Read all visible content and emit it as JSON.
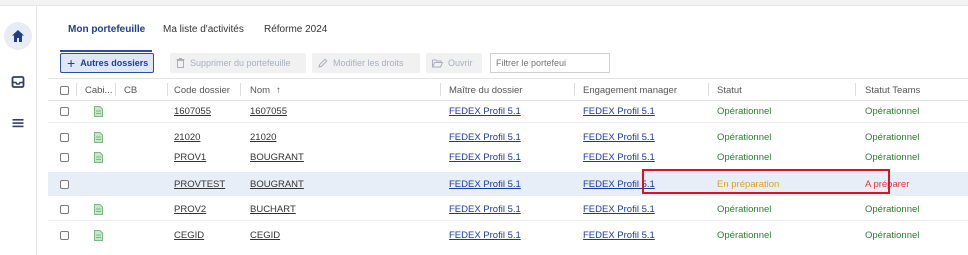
{
  "tabs": [
    {
      "label": "Mon portefeuille",
      "active": true
    },
    {
      "label": "Ma liste d'activités",
      "active": false
    },
    {
      "label": "Réforme 2024",
      "active": false
    }
  ],
  "toolbar": {
    "other_folders": "Autres dossiers",
    "delete_portfolio": "Supprimer du portefeuille",
    "modify_rights": "Modifier les droits",
    "open": "Ouvrir",
    "filter_placeholder": "Filtrer le portefeui"
  },
  "columns": [
    "Cabi...",
    "CB",
    "Code dossier",
    "Nom",
    "Maître du dossier",
    "Engagement manager",
    "Statut",
    "Statut Teams"
  ],
  "sort_indicator": "↑",
  "rows": [
    {
      "icon": true,
      "code": "1607055",
      "nom": "1607055",
      "maitre": "FEDEX Profil 5.1",
      "engagement": "FEDEX Profil 5.1",
      "statut": "Opérationnel",
      "statut_teams": "Opérationnel"
    },
    {
      "icon": true,
      "code": "21020",
      "nom": "21020",
      "maitre": "FEDEX Profil 5.1",
      "engagement": "FEDEX Profil 5.1",
      "statut": "Opérationnel",
      "statut_teams": "Opérationnel"
    },
    {
      "icon": true,
      "code": "PROV1",
      "nom": "BOUGRANT",
      "maitre": "FEDEX Profil 5.1",
      "engagement": "FEDEX Profil 5.1",
      "statut": "Opérationnel",
      "statut_teams": "Opérationnel"
    },
    {
      "icon": false,
      "code": "PROVTEST",
      "nom": "BOUGRANT",
      "maitre": "FEDEX Profil 5.1",
      "engagement": "FEDEX Profil 5.1",
      "statut": "En préparation",
      "statut_teams": "A préparer"
    },
    {
      "icon": true,
      "code": "PROV2",
      "nom": "BUCHART",
      "maitre": "FEDEX Profil 5.1",
      "engagement": "FEDEX Profil 5.1",
      "statut": "Opérationnel",
      "statut_teams": "Opérationnel"
    },
    {
      "icon": true,
      "code": "CEGID",
      "nom": "CEGID",
      "maitre": "FEDEX Profil 5.1",
      "engagement": "FEDEX Profil 5.1",
      "statut": "Opérationnel",
      "statut_teams": "Opérationnel"
    }
  ],
  "colors": {
    "accent": "#2b4fa0",
    "ok": "#2e7d32",
    "warning": "#e0a020",
    "alert": "#e53935",
    "highlight_box": "#e0101e"
  },
  "icons": {
    "sidebar": [
      "home-icon",
      "inbox-icon",
      "menu-icon"
    ],
    "row": "document-icon"
  }
}
